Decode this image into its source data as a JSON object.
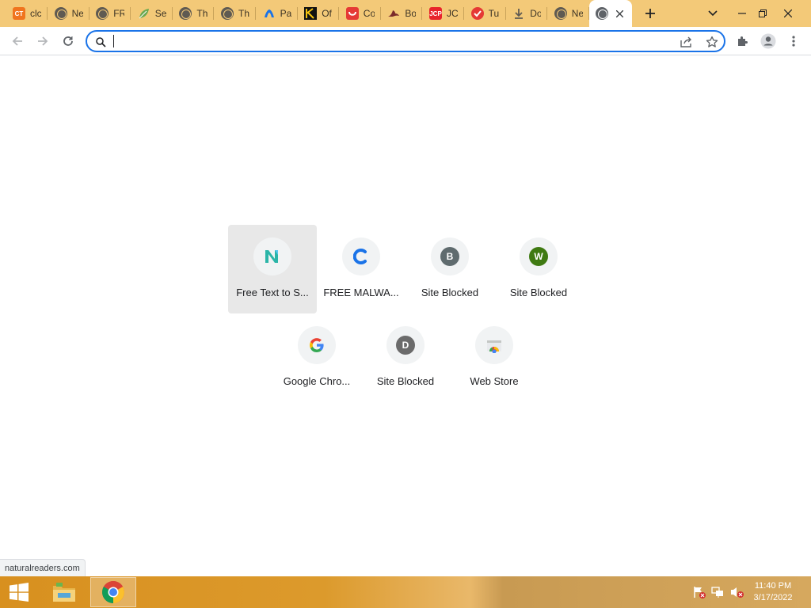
{
  "tabs": [
    {
      "favicon": "ct-logo-icon",
      "favicon_text": "CT",
      "favicon_color": "#f0741e",
      "title": "clc"
    },
    {
      "favicon": "globe-icon",
      "title": "Ne"
    },
    {
      "favicon": "globe-icon",
      "title": "FR"
    },
    {
      "favicon": "leaf-icon",
      "title": "Se"
    },
    {
      "favicon": "globe-icon",
      "title": "Th"
    },
    {
      "favicon": "globe-icon",
      "title": "Th"
    },
    {
      "favicon": "pa-logo-icon",
      "title": "Pa"
    },
    {
      "favicon": "k-logo-icon",
      "title": "Of"
    },
    {
      "favicon": "cc-logo-icon",
      "title": "Co"
    },
    {
      "favicon": "bird-icon",
      "title": "Bo"
    },
    {
      "favicon": "jcp-logo-icon",
      "favicon_text": "JCP",
      "favicon_color": "#e8232b",
      "title": "JC"
    },
    {
      "favicon": "check-logo-icon",
      "title": "Tu"
    },
    {
      "favicon": "download-icon",
      "title": "Do"
    },
    {
      "favicon": "globe-icon",
      "title": "Ne"
    },
    {
      "favicon": "globe-icon",
      "title": "",
      "active": true
    }
  ],
  "toolbar": {
    "omnibox_value": ""
  },
  "shortcuts": [
    {
      "label": "Free Text to S...",
      "icon": "naturalreaders-icon",
      "hover": true
    },
    {
      "label": "FREE MALWA...",
      "icon": "c-logo-icon"
    },
    {
      "label": "Site Blocked",
      "letter": "B",
      "color": "#5f6b6e"
    },
    {
      "label": "Site Blocked",
      "letter": "W",
      "color": "#3f7a12"
    },
    {
      "label": "Google Chro...",
      "icon": "google-icon"
    },
    {
      "label": "Site Blocked",
      "letter": "D",
      "color": "#6b6b6b"
    },
    {
      "label": "Web Store",
      "icon": "web-store-icon"
    }
  ],
  "status_url": "naturalreaders.com",
  "taskbar": {
    "time": "11:40 PM",
    "date": "3/17/2022"
  },
  "colors": {
    "tabstrip": "#f3c978",
    "omnibox_focus": "#1a73e8",
    "taskbar": "#d8901f"
  }
}
